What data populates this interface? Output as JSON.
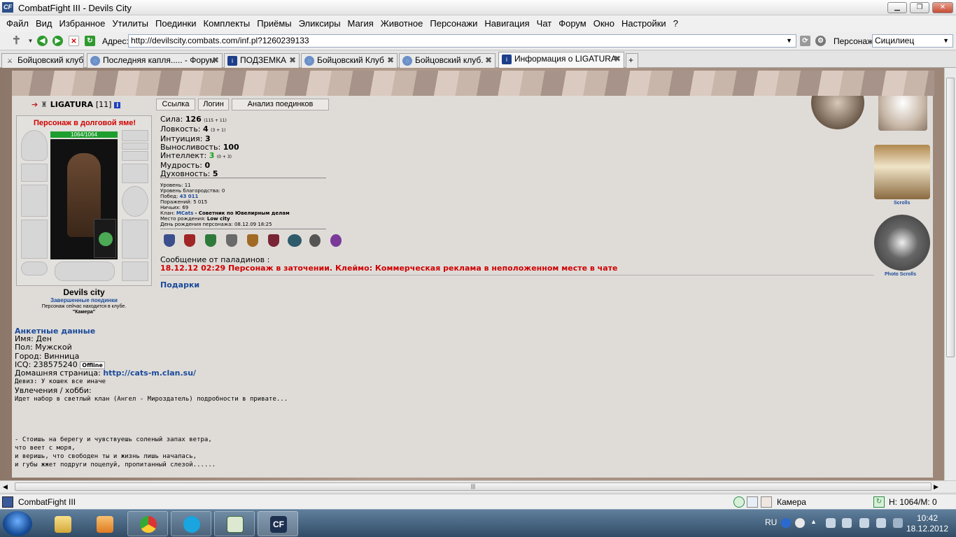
{
  "window": {
    "app_icon": "CF",
    "title": "CombatFight III - Devils City"
  },
  "menu": [
    "Файл",
    "Вид",
    "Избранное",
    "Утилиты",
    "Поединки",
    "Комплекты",
    "Приёмы",
    "Эликсиры",
    "Магия",
    "Животное",
    "Персонажи",
    "Навигация",
    "Чат",
    "Форум",
    "Окно",
    "Настройки",
    "?"
  ],
  "address": {
    "label": "Адрес:",
    "url": "http://devilscity.combats.com/inf.pl?1260239133",
    "character_label": "Персонаж:",
    "character": "Сицилиец"
  },
  "tabs": [
    {
      "label": "Бойцовский клуб",
      "active": false
    },
    {
      "label": "Последняя капля..... - Форум",
      "active": false
    },
    {
      "label": "ПОДЗЕМКА",
      "active": false
    },
    {
      "label": "Бойцовский Клуб",
      "active": false
    },
    {
      "label": "Бойцовский клуб.",
      "active": false
    },
    {
      "label": "Информация о LIGATURA",
      "active": true
    }
  ],
  "character": {
    "name": "LIGATURA",
    "level": "[11]",
    "debt_notice": "Персонаж в долговой яме!",
    "hp": "1064/1064",
    "city": "Devils city",
    "finished_fights": "Завершенные поединки",
    "location_note": "Персонаж сейчас находится в клубе.",
    "room": "\"Камера\""
  },
  "top_buttons": {
    "link": "Ссылка",
    "login": "Логин",
    "analysis": "Анализ поединков"
  },
  "stats": [
    {
      "label": "Сила:",
      "value": "126",
      "extra": "(115 + 11)"
    },
    {
      "label": "Ловкость:",
      "value": "4",
      "extra": "(3 + 1)"
    },
    {
      "label": "Интуиция:",
      "value": "3",
      "extra": ""
    },
    {
      "label": "Выносливость:",
      "value": "100",
      "extra": ""
    },
    {
      "label": "Интеллект:",
      "value": "3",
      "extra": "(0 + 3)"
    },
    {
      "label": "Мудрость:",
      "value": "0",
      "extra": ""
    },
    {
      "label": "Духовность:",
      "value": "5",
      "extra": ""
    }
  ],
  "details": {
    "level": "Уровень: 11",
    "valor": "Уровень благородства: 0",
    "wins_label": "Побед:",
    "wins": "43 011",
    "losses": "Поражений: 5 015",
    "draws": "Ничьих: 69",
    "clan_label": "Клан:",
    "clan": "MCats",
    "clan_role": "- Советник по Ювелирным делам",
    "birthplace_label": "Место рождения:",
    "birthplace": "Low city",
    "birthday": "День рождения персонажа: 08.12.09 18:25"
  },
  "paladin": {
    "title": "Сообщение от паладинов :",
    "message": "18.12.12 02:29 Персонаж в заточении. Клеймо: Коммерческая реклама в неположенном месте в чате"
  },
  "gifts": "Подарки",
  "profile": {
    "header": "Анкетные данные",
    "name": "Имя: Ден",
    "gender": "Пол: Мужской",
    "city": "Город: Винница",
    "icq": "ICQ: 238575240",
    "icq_status": "Offline",
    "homepage_label": "Домашняя страница:",
    "homepage": "http://cats-m.clan.su/",
    "motto": "Девиз: У кошек все иначе",
    "hobby_label": "Увлечения / хобби:",
    "hobby": "Идет набор в светлый клан (Ангел - Мироздатель)  подробности в привате...",
    "poem": [
      "- Стоишь на берегу и чувствуешь соленый запах ветра,",
      "что веет с моря,",
      "и веришь, что свободен ты и жизнь лишь началась,",
      "и губы жжет подруги поцелуй, пропитанный слезой......"
    ]
  },
  "side_links": {
    "scrolls": "Scrolls",
    "photo": "Photo Scrolls"
  },
  "statusbar": {
    "app": "CombatFight III",
    "room": "Камера",
    "hp": "H: 1064/M: 0"
  },
  "taskbar": {
    "lang": "RU",
    "time": "10:42",
    "date": "18.12.2012"
  },
  "colors": {
    "accent": "#1a4a9a",
    "alert": "#d00000",
    "hp": "#1e9e2e"
  }
}
